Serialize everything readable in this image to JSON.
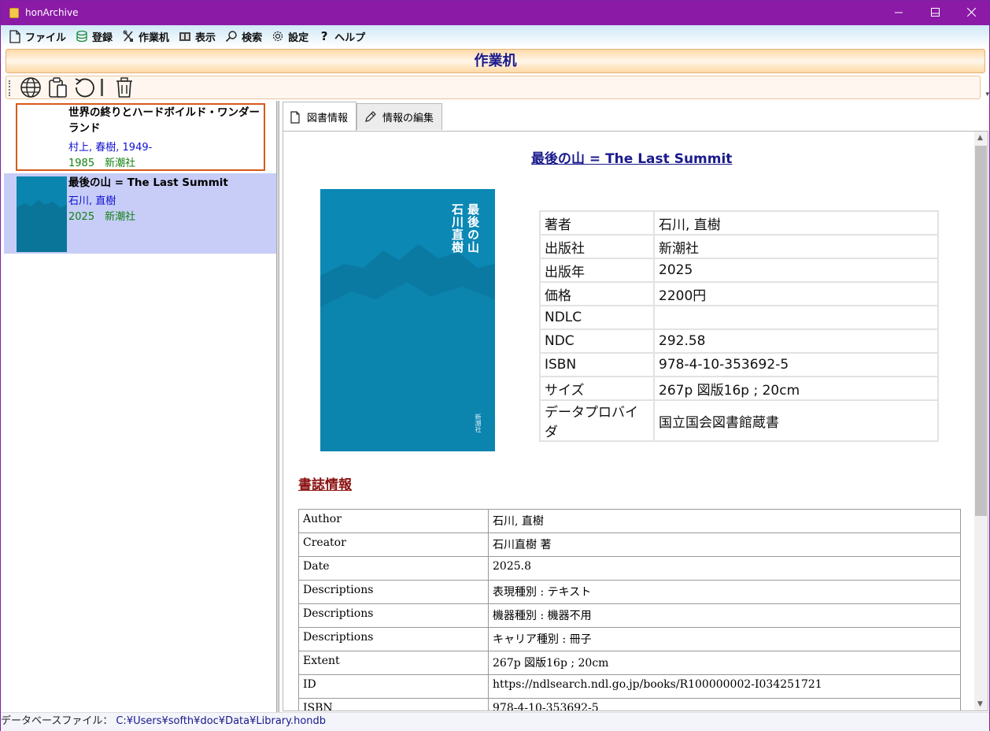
{
  "window": {
    "title": "honArchive",
    "accent_color": "#8b1aa6"
  },
  "menu": [
    {
      "label": "ファイル",
      "icon": "file-icon"
    },
    {
      "label": "登録",
      "icon": "database-icon"
    },
    {
      "label": "作業机",
      "icon": "tools-icon"
    },
    {
      "label": "表示",
      "icon": "view-icon"
    },
    {
      "label": "検索",
      "icon": "search-icon"
    },
    {
      "label": "設定",
      "icon": "gear-icon"
    },
    {
      "label": "ヘルプ",
      "icon": "help-icon"
    }
  ],
  "header": {
    "title": "作業机"
  },
  "toolbar": {
    "buttons": [
      "globe-icon",
      "clipboard-icon",
      "refresh-icon",
      "trash-icon"
    ]
  },
  "book_list": [
    {
      "title": "世界の終りとハードボイルド・ワンダーランド",
      "title_line1": "世界の終りとハードボイルド・ワンダー",
      "title_line2": "ランド",
      "author": "村上, 春樹, 1949-",
      "meta": "1985　新潮社"
    },
    {
      "title": "最後の山 = The Last Summit",
      "author": "石川, 直樹",
      "meta": "2025　新潮社"
    }
  ],
  "tabs": [
    {
      "label": "図書情報",
      "icon": "document-icon"
    },
    {
      "label": "情報の編集",
      "icon": "pencil-icon"
    }
  ],
  "detail": {
    "heading": "最後の山 = The Last Summit",
    "cover": {
      "title": "最後の山 石川直樹",
      "publisher": "新潮社"
    },
    "info": [
      {
        "key": "著者",
        "value": "石川, 直樹"
      },
      {
        "key": "出版社",
        "value": "新潮社"
      },
      {
        "key": "出版年",
        "value": "2025"
      },
      {
        "key": "価格",
        "value": "2200円"
      },
      {
        "key": "NDLC",
        "value": ""
      },
      {
        "key": "NDC",
        "value": "292.58"
      },
      {
        "key": "ISBN",
        "value": "978-4-10-353692-5"
      },
      {
        "key": "サイズ",
        "value": "267p 図版16p ; 20cm"
      },
      {
        "key": "データプロバイダ",
        "value": "国立国会図書館蔵書"
      }
    ],
    "biblio_heading": "書誌情報",
    "biblio": [
      {
        "key": "Author",
        "value": "石川, 直樹"
      },
      {
        "key": "Creator",
        "value": "石川直樹 著"
      },
      {
        "key": "Date",
        "value": "2025.8"
      },
      {
        "key": "Descriptions",
        "value": "表現種別 : テキスト"
      },
      {
        "key": "Descriptions",
        "value": "機器種別 : 機器不用"
      },
      {
        "key": "Descriptions",
        "value": "キャリア種別 : 冊子"
      },
      {
        "key": "Extent",
        "value": "267p 図版16p ; 20cm"
      },
      {
        "key": "ID",
        "value": "https://ndlsearch.ndl.go.jp/books/R100000002-I034251721"
      },
      {
        "key": "ISBN",
        "value": "978-4-10-353692-5"
      }
    ]
  },
  "status": {
    "label": "データベースファイル：",
    "path": "C:¥Users¥softh¥doc¥Data¥Library.hondb"
  }
}
